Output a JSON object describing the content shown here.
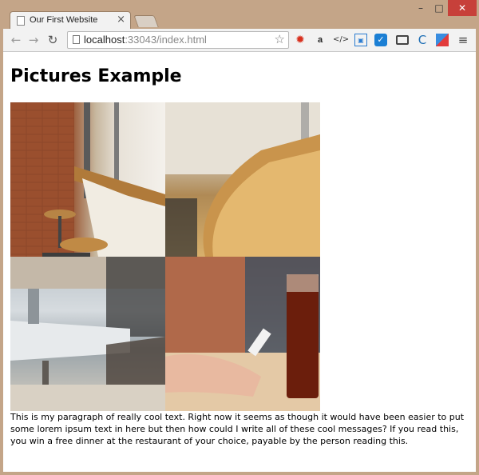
{
  "browser": {
    "tab_title": "Our First Website",
    "tab_close": "×",
    "url_host": "localhost",
    "url_rest": ":33043/index.html",
    "window_controls": {
      "minimize": "–",
      "maximize": "□",
      "close": "✕"
    },
    "icons": [
      "back-icon",
      "forward-icon",
      "reload-icon",
      "page-icon",
      "star-icon",
      "settings-icon"
    ]
  },
  "page": {
    "title": "Pictures Example",
    "paragraph": "This is my paragraph of really cool text. Right now it seems as though it would have been easier to put some lorem ipsum text in here but then how could I write all of these cool messages? If you read this, you win a free dinner at the restaurant of your choice, payable by the person reading this."
  }
}
